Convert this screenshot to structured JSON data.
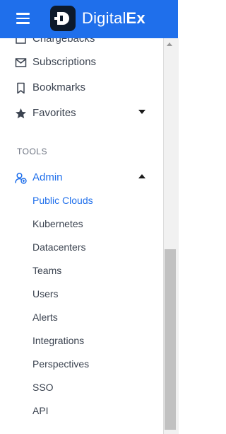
{
  "header": {
    "brand_prefix": "Digital",
    "brand_suffix": "Ex",
    "background": "#1f6feb"
  },
  "sidebar": {
    "partial_item": "Chargebacks",
    "items": [
      {
        "label": "Subscriptions",
        "icon": "mail-icon"
      },
      {
        "label": "Bookmarks",
        "icon": "bookmark-icon"
      },
      {
        "label": "Favorites",
        "icon": "star-icon"
      }
    ],
    "section_title": "TOOLS",
    "admin": {
      "label": "Admin",
      "icon": "user-add-icon",
      "children": [
        "Public Clouds",
        "Kubernetes",
        "Datacenters",
        "Teams",
        "Users",
        "Alerts",
        "Integrations",
        "Perspectives",
        "SSO",
        "API"
      ]
    }
  },
  "accent_color": "#1f6feb"
}
